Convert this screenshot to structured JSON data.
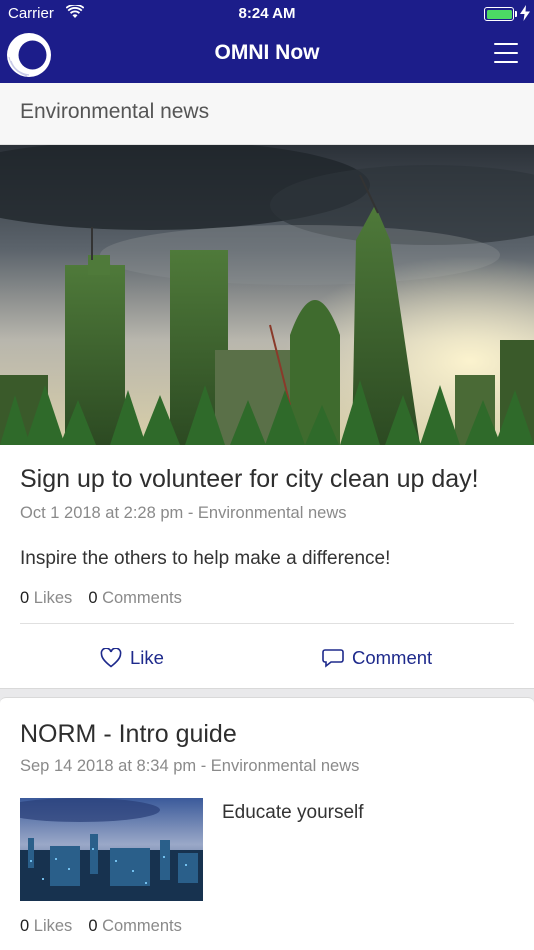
{
  "status_bar": {
    "carrier": "Carrier",
    "time": "8:24 AM"
  },
  "nav": {
    "title": "OMNI Now"
  },
  "section": {
    "title": "Environmental news"
  },
  "posts": [
    {
      "title": "Sign up to volunteer for city clean up day!",
      "meta": "Oct 1 2018 at 2:28 pm - Environmental news",
      "body": "Inspire the others to help make a difference!",
      "likes_count": "0",
      "likes_label": "Likes",
      "comments_count": "0",
      "comments_label": "Comments",
      "like_action": "Like",
      "comment_action": "Comment"
    },
    {
      "title": "NORM - Intro guide",
      "meta": "Sep 14 2018 at 8:34 pm - Environmental news",
      "body": "Educate yourself",
      "likes_count": "0",
      "likes_label": "Likes",
      "comments_count": "0",
      "comments_label": "Comments"
    }
  ],
  "colors": {
    "nav_bg": "#1c1d8a",
    "accent": "#1e2a8c",
    "battery": "#4cd964"
  }
}
